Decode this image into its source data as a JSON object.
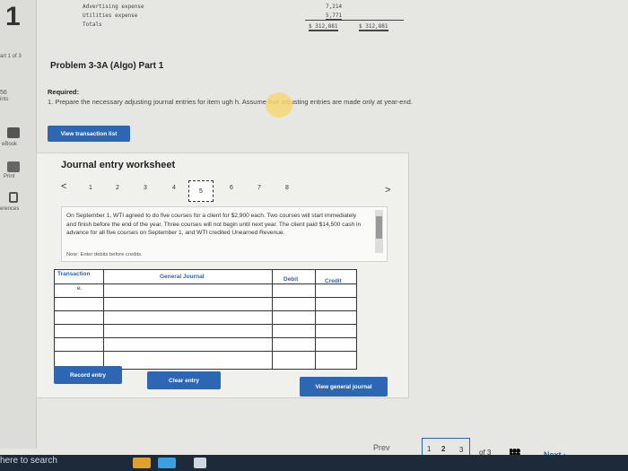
{
  "left_rail": {
    "big_number": "1",
    "part_label": "art 1 of 3",
    "score_top": "56",
    "score_sub": "ints",
    "items": [
      "eBook",
      "Print",
      "erences"
    ]
  },
  "ledger_fragment": {
    "rows": [
      {
        "label": "Advertising expense",
        "amount": "7,214"
      },
      {
        "label": "Utilities expense",
        "amount": "5,771"
      },
      {
        "label": "Totals",
        "debit_total": "$ 312,881",
        "credit_total": "$ 312,881"
      }
    ]
  },
  "problem": {
    "title": "Problem 3-3A (Algo) Part 1",
    "required_label": "Required:",
    "instruction": "1. Prepare the necessary adjusting journal entries for item    ugh h. Assume that adjusting entries are made only at year-end."
  },
  "buttons": {
    "view_transaction_list": "View transaction list",
    "record_entry": "Record entry",
    "clear_entry": "Clear entry",
    "view_general_journal": "View general journal"
  },
  "worksheet": {
    "title": "Journal entry worksheet",
    "prev_arrow": "<",
    "next_arrow": ">",
    "tabs": [
      "1",
      "2",
      "3",
      "4",
      "5",
      "6",
      "7",
      "8"
    ],
    "selected_tab": "5",
    "description": "On September 1, WTI agreed to do five courses for a client for $2,900 each. Two courses will start immediately and finish before the end of the year. Three courses will not begin until next year. The client paid $14,500 cash in advance for all five courses on September 1, and WTI credited Unearned Revenue.",
    "note": "Note: Enter debits before credits.",
    "table": {
      "headers": {
        "transaction": "Transaction",
        "general_journal": "General Journal",
        "debit": "Debit",
        "credit": "Credit"
      },
      "first_row_transaction": "e."
    }
  },
  "pager": {
    "prev": "Prev",
    "pages": [
      "1",
      "2",
      "3"
    ],
    "of_label": "of 3",
    "next": "Next"
  },
  "taskbar": {
    "search_text": "here to search"
  },
  "colors": {
    "accent": "#2d66b3",
    "highlight": "#f7d774"
  }
}
